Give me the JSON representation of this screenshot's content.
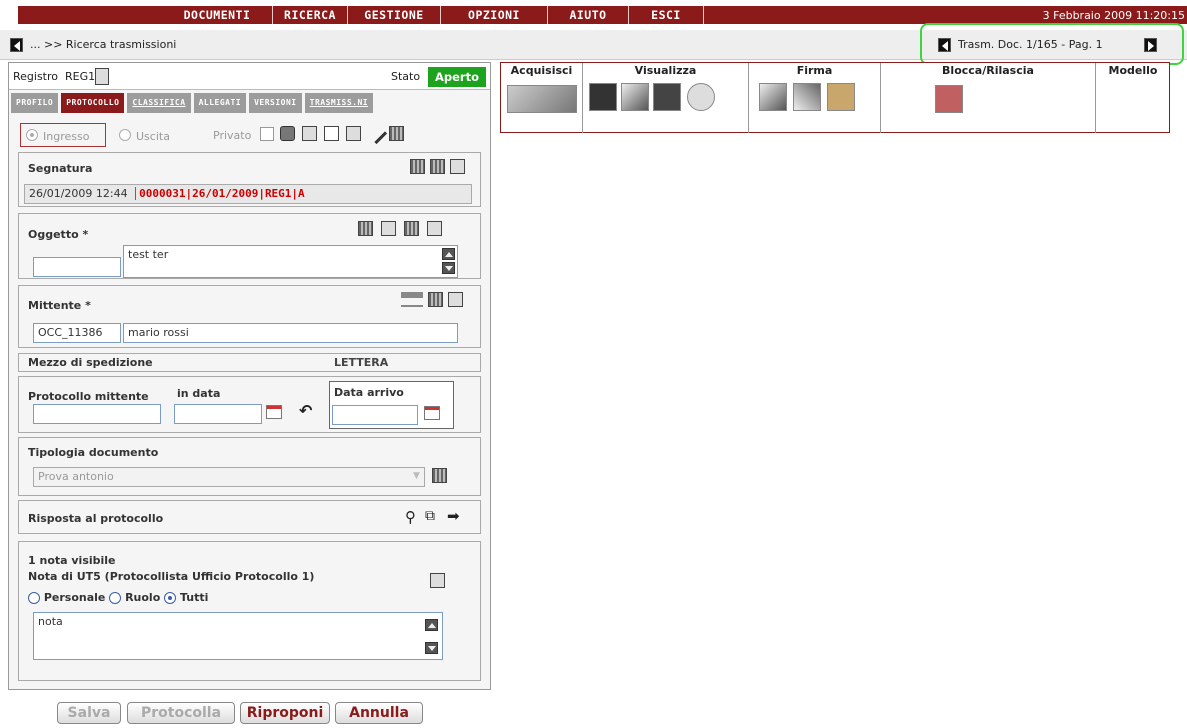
{
  "menu": {
    "items": [
      "DOCUMENTI",
      "RICERCA",
      "GESTIONE",
      "OPZIONI",
      "AIUTO",
      "ESCI"
    ],
    "datetime": "3 Febbraio 2009 11:20:15"
  },
  "breadcrumb": "... >> Ricerca trasmissioni",
  "pager": {
    "label": "Trasm. Doc. 1/165 - Pag. 1"
  },
  "registro": {
    "label": "Registro",
    "value": "REG1",
    "stato_label": "Stato",
    "stato_value": "Aperto"
  },
  "tabs": [
    "PROFILO",
    "PROTOCOLLO",
    "CLASSIFICA",
    "ALLEGATI",
    "VERSIONI",
    "TRASMISS.NI"
  ],
  "direction": {
    "ingresso": "Ingresso",
    "uscita": "Uscita",
    "privato": "Privato"
  },
  "segnatura": {
    "title": "Segnatura",
    "date": "26/01/2009 12:44",
    "code": "0000031|26/01/2009|REG1|A"
  },
  "oggetto": {
    "title": "Oggetto *",
    "code": "",
    "text": "test ter"
  },
  "mittente": {
    "title": "Mittente *",
    "code": "OCC_11386",
    "name": "mario rossi"
  },
  "mezzo": {
    "label": "Mezzo di spedizione",
    "value": "LETTERA"
  },
  "protocollo_mittente": {
    "label": "Protocollo mittente",
    "in_data_label": "in data",
    "data_arrivo_label": "Data arrivo",
    "value": "",
    "in_data": "",
    "data_arrivo": ""
  },
  "tipologia": {
    "label": "Tipologia documento",
    "value": "Prova antonio"
  },
  "risposta": {
    "label": "Risposta al protocollo"
  },
  "note": {
    "count_label": "1 nota visibile",
    "author": "Nota di UT5 (Protocollista Ufficio Protocollo 1)",
    "options": [
      "Personale",
      "Ruolo",
      "Tutti"
    ],
    "selected": "Tutti",
    "text": "nota"
  },
  "toolbar": {
    "headers": [
      "Acquisisci",
      "Visualizza",
      "Firma",
      "Blocca/Rilascia",
      "Modello"
    ]
  },
  "buttons": {
    "salva": "Salva",
    "protocolla": "Protocolla",
    "riproponi": "Riproponi",
    "annulla": "Annulla"
  }
}
